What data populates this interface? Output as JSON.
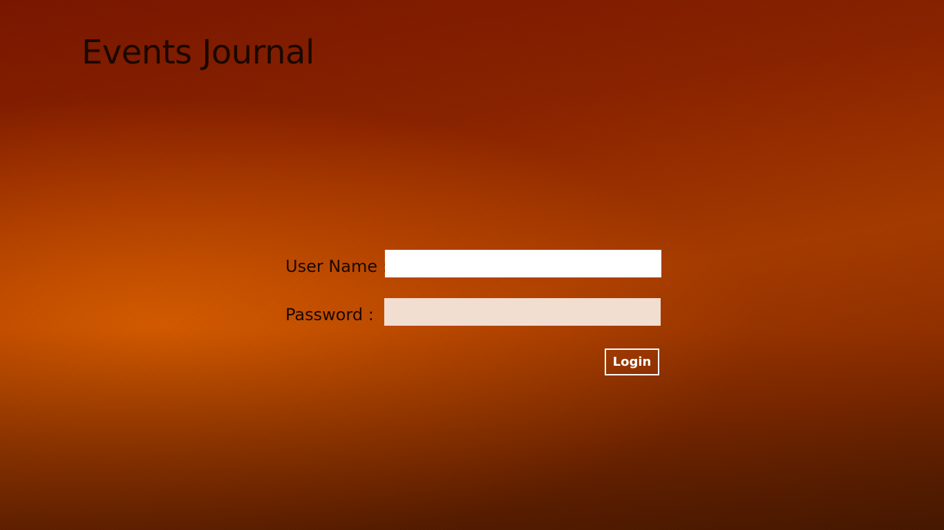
{
  "app": {
    "title": "Events Journal"
  },
  "login_form": {
    "username_label": "User Name :",
    "username_value": "",
    "password_label": "Password :",
    "password_value": "",
    "login_label": "Login"
  },
  "colors": {
    "background_accent": "#c45200",
    "background_dark": "#6e1200",
    "text": "#1a0800",
    "username_field_bg": "#ffffff",
    "password_field_bg": "#f2ddd1",
    "button_border": "#ffffff"
  }
}
